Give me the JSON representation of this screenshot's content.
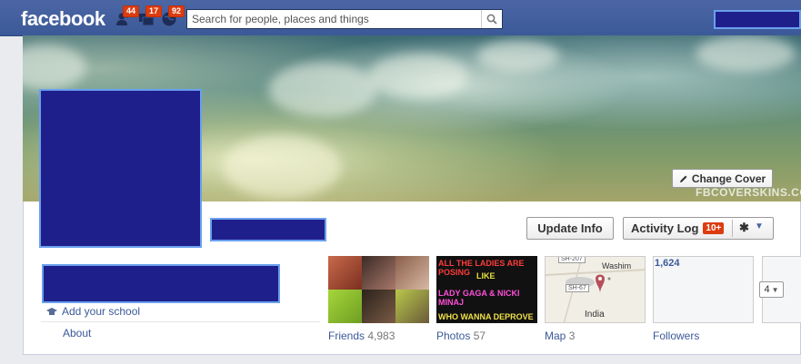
{
  "app": {
    "logo_text": "facebook"
  },
  "jewels": [
    {
      "icon": "friend-requests-icon",
      "count": "44"
    },
    {
      "icon": "messages-icon",
      "count": "17"
    },
    {
      "icon": "notifications-icon",
      "count": "92"
    }
  ],
  "search": {
    "placeholder": "Search for people, places and things",
    "value": ""
  },
  "cover": {
    "change_cover_label": "Change Cover",
    "watermark": "FBCOVERSKINS.COM"
  },
  "actions": {
    "update_info_label": "Update Info",
    "activity_log_label": "Activity Log",
    "activity_log_count": "10+"
  },
  "intro": {
    "school_label": "Add your school",
    "about_label": "About"
  },
  "tiles": {
    "friends": {
      "label": "Friends",
      "count": "4,983"
    },
    "photos": {
      "label": "Photos",
      "count": "57",
      "image_text": [
        "ALL THE LADIES ARE POSING",
        "LIKE",
        "LADY GAGA & NICKI MINAJ",
        "WHO WANNA DEPROVE"
      ]
    },
    "map": {
      "label": "Map",
      "count": "3",
      "place_1": "Washim",
      "place_2": "India",
      "road_1": "SH-207",
      "road_2": "SH-67"
    },
    "followers": {
      "label": "Followers",
      "count": "1,624"
    },
    "more_count": "4"
  },
  "colors": {
    "brand_blue": "#3b5998",
    "badge_red": "#dd3c10",
    "redaction": "#1f1f8c"
  }
}
